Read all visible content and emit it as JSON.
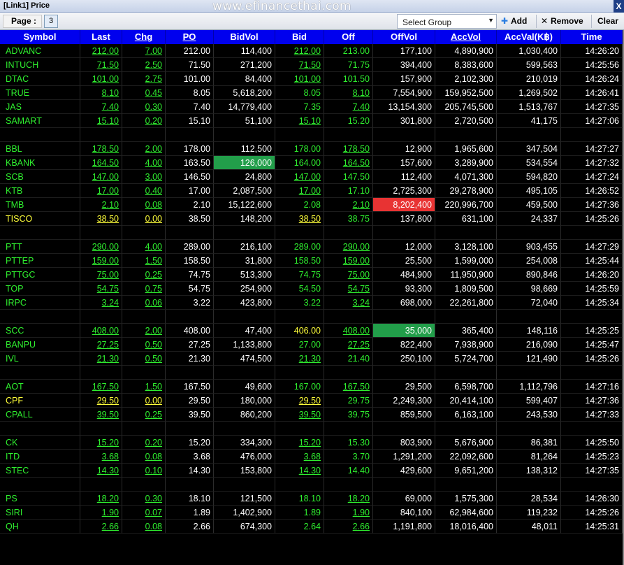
{
  "window": {
    "title": "[Link1] Price",
    "watermark": "www.efinancethai.com",
    "close_label": "X"
  },
  "toolbar": {
    "page_label": "Page :",
    "page_value": "3",
    "group_select": "Select Group",
    "add_label": "Add",
    "remove_label": "Remove",
    "clear_label": "Clear"
  },
  "columns": [
    "Symbol",
    "Last",
    "Chg",
    "PO",
    "BidVol",
    "Bid",
    "Off",
    "OffVol",
    "AccVol",
    "AccVal(K฿)",
    "Time"
  ],
  "colors": {
    "up": "#2ff02f",
    "unchanged": "#ffff3a",
    "header_bg": "#0000ee",
    "hl_green": "#229e4a",
    "hl_red": "#e83333"
  },
  "rows": [
    {
      "symbol": "ADVANC",
      "last": "212.00",
      "chg": "7.00",
      "po": "212.00",
      "bidvol": "114,400",
      "bid": "212.00",
      "off": "213.00",
      "offvol": "177,100",
      "accvol": "4,890,900",
      "accval": "1,030,400",
      "time": "14:26:20",
      "color": "green"
    },
    {
      "symbol": "INTUCH",
      "last": "71.50",
      "chg": "2.50",
      "po": "71.50",
      "bidvol": "271,200",
      "bid": "71.50",
      "off": "71.75",
      "offvol": "394,400",
      "accvol": "8,383,600",
      "accval": "599,563",
      "time": "14:25:56",
      "color": "green"
    },
    {
      "symbol": "DTAC",
      "last": "101.00",
      "chg": "2.75",
      "po": "101.00",
      "bidvol": "84,400",
      "bid": "101.00",
      "off": "101.50",
      "offvol": "157,900",
      "accvol": "2,102,300",
      "accval": "210,019",
      "time": "14:26:24",
      "color": "green"
    },
    {
      "symbol": "TRUE",
      "last": "8.10",
      "chg": "0.45",
      "po": "8.05",
      "bidvol": "5,618,200",
      "bid": "8.05",
      "off": "8.10",
      "offvol": "7,554,900",
      "accvol": "159,952,500",
      "accval": "1,269,502",
      "time": "14:26:41",
      "color": "green",
      "bid_plain": true,
      "off_ul": true
    },
    {
      "symbol": "JAS",
      "last": "7.40",
      "chg": "0.30",
      "po": "7.40",
      "bidvol": "14,779,400",
      "bid": "7.35",
      "off": "7.40",
      "offvol": "13,154,300",
      "accvol": "205,745,500",
      "accval": "1,513,767",
      "time": "14:27:35",
      "color": "green",
      "bid_plain": true,
      "off_ul": true
    },
    {
      "symbol": "SAMART",
      "last": "15.10",
      "chg": "0.20",
      "po": "15.10",
      "bidvol": "51,100",
      "bid": "15.10",
      "off": "15.20",
      "offvol": "301,800",
      "accvol": "2,720,500",
      "accval": "41,175",
      "time": "14:27:06",
      "color": "green"
    },
    {
      "blank": true
    },
    {
      "symbol": "BBL",
      "last": "178.50",
      "chg": "2.00",
      "po": "178.00",
      "bidvol": "112,500",
      "bid": "178.00",
      "off": "178.50",
      "offvol": "12,900",
      "accvol": "1,965,600",
      "accval": "347,504",
      "time": "14:27:27",
      "color": "green",
      "bid_plain": true,
      "off_ul": true
    },
    {
      "symbol": "KBANK",
      "last": "164.50",
      "chg": "4.00",
      "po": "163.50",
      "bidvol": "126,000",
      "bid": "164.00",
      "off": "164.50",
      "offvol": "157,600",
      "accvol": "3,289,900",
      "accval": "534,554",
      "time": "14:27:32",
      "color": "green",
      "bid_plain": true,
      "off_ul": true,
      "bidvol_hl": "green"
    },
    {
      "symbol": "SCB",
      "last": "147.00",
      "chg": "3.00",
      "po": "146.50",
      "bidvol": "24,800",
      "bid": "147.00",
      "off": "147.50",
      "offvol": "112,400",
      "accvol": "4,071,300",
      "accval": "594,820",
      "time": "14:27:24",
      "color": "green"
    },
    {
      "symbol": "KTB",
      "last": "17.00",
      "chg": "0.40",
      "po": "17.00",
      "bidvol": "2,087,500",
      "bid": "17.00",
      "off": "17.10",
      "offvol": "2,725,300",
      "accvol": "29,278,900",
      "accval": "495,105",
      "time": "14:26:52",
      "color": "green"
    },
    {
      "symbol": "TMB",
      "last": "2.10",
      "chg": "0.08",
      "po": "2.10",
      "bidvol": "15,122,600",
      "bid": "2.08",
      "off": "2.10",
      "offvol": "8,202,400",
      "accvol": "220,996,700",
      "accval": "459,500",
      "time": "14:27:36",
      "color": "green",
      "bid_plain": true,
      "off_ul": true,
      "offvol_hl": "red"
    },
    {
      "symbol": "TISCO",
      "last": "38.50",
      "chg": "0.00",
      "po": "38.50",
      "bidvol": "148,200",
      "bid": "38.50",
      "off": "38.75",
      "offvol": "137,800",
      "accvol": "631,100",
      "accval": "24,337",
      "time": "14:25:26",
      "color": "yellow",
      "bid_yellow": true
    },
    {
      "blank": true
    },
    {
      "symbol": "PTT",
      "last": "290.00",
      "chg": "4.00",
      "po": "289.00",
      "bidvol": "216,100",
      "bid": "289.00",
      "off": "290.00",
      "offvol": "12,000",
      "accvol": "3,128,100",
      "accval": "903,455",
      "time": "14:27:29",
      "color": "green",
      "bid_plain": true,
      "off_ul": true
    },
    {
      "symbol": "PTTEP",
      "last": "159.00",
      "chg": "1.50",
      "po": "158.50",
      "bidvol": "31,800",
      "bid": "158.50",
      "off": "159.00",
      "offvol": "25,500",
      "accvol": "1,599,000",
      "accval": "254,008",
      "time": "14:25:44",
      "color": "green",
      "bid_plain": true,
      "off_ul": true
    },
    {
      "symbol": "PTTGC",
      "last": "75.00",
      "chg": "0.25",
      "po": "74.75",
      "bidvol": "513,300",
      "bid": "74.75",
      "off": "75.00",
      "offvol": "484,900",
      "accvol": "11,950,900",
      "accval": "890,846",
      "time": "14:26:20",
      "color": "green",
      "bid_plain": true,
      "off_ul": true
    },
    {
      "symbol": "TOP",
      "last": "54.75",
      "chg": "0.75",
      "po": "54.75",
      "bidvol": "254,900",
      "bid": "54.50",
      "off": "54.75",
      "offvol": "93,300",
      "accvol": "1,809,500",
      "accval": "98,669",
      "time": "14:25:59",
      "color": "green",
      "bid_plain": true,
      "off_ul": true
    },
    {
      "symbol": "IRPC",
      "last": "3.24",
      "chg": "0.06",
      "po": "3.22",
      "bidvol": "423,800",
      "bid": "3.22",
      "off": "3.24",
      "offvol": "698,000",
      "accvol": "22,261,800",
      "accval": "72,040",
      "time": "14:25:34",
      "color": "green",
      "bid_plain": true,
      "off_ul": true
    },
    {
      "blank": true
    },
    {
      "symbol": "SCC",
      "last": "408.00",
      "chg": "2.00",
      "po": "408.00",
      "bidvol": "47,400",
      "bid": "406.00",
      "off": "408.00",
      "offvol": "35,000",
      "accvol": "365,400",
      "accval": "148,116",
      "time": "14:25:25",
      "color": "green",
      "bid_yellow_plain": true,
      "off_ul": true,
      "offvol_hl": "green"
    },
    {
      "symbol": "BANPU",
      "last": "27.25",
      "chg": "0.50",
      "po": "27.25",
      "bidvol": "1,133,800",
      "bid": "27.00",
      "off": "27.25",
      "offvol": "822,400",
      "accvol": "7,938,900",
      "accval": "216,090",
      "time": "14:25:47",
      "color": "green",
      "bid_plain": true,
      "off_ul": true
    },
    {
      "symbol": "IVL",
      "last": "21.30",
      "chg": "0.50",
      "po": "21.30",
      "bidvol": "474,500",
      "bid": "21.30",
      "off": "21.40",
      "offvol": "250,100",
      "accvol": "5,724,700",
      "accval": "121,490",
      "time": "14:25:26",
      "color": "green"
    },
    {
      "blank": true
    },
    {
      "symbol": "AOT",
      "last": "167.50",
      "chg": "1.50",
      "po": "167.50",
      "bidvol": "49,600",
      "bid": "167.00",
      "off": "167.50",
      "offvol": "29,500",
      "accvol": "6,598,700",
      "accval": "1,112,796",
      "time": "14:27:16",
      "color": "green",
      "bid_plain": true,
      "off_ul": true
    },
    {
      "symbol": "CPF",
      "last": "29.50",
      "chg": "0.00",
      "po": "29.50",
      "bidvol": "180,000",
      "bid": "29.50",
      "off": "29.75",
      "offvol": "2,249,300",
      "accvol": "20,414,100",
      "accval": "599,407",
      "time": "14:27:36",
      "color": "yellow",
      "bid_yellow": true
    },
    {
      "symbol": "CPALL",
      "last": "39.50",
      "chg": "0.25",
      "po": "39.50",
      "bidvol": "860,200",
      "bid": "39.50",
      "off": "39.75",
      "offvol": "859,500",
      "accvol": "6,163,100",
      "accval": "243,530",
      "time": "14:27:33",
      "color": "green"
    },
    {
      "blank": true
    },
    {
      "symbol": "CK",
      "last": "15.20",
      "chg": "0.20",
      "po": "15.20",
      "bidvol": "334,300",
      "bid": "15.20",
      "off": "15.30",
      "offvol": "803,900",
      "accvol": "5,676,900",
      "accval": "86,381",
      "time": "14:25:50",
      "color": "green"
    },
    {
      "symbol": "ITD",
      "last": "3.68",
      "chg": "0.08",
      "po": "3.68",
      "bidvol": "476,000",
      "bid": "3.68",
      "off": "3.70",
      "offvol": "1,291,200",
      "accvol": "22,092,600",
      "accval": "81,264",
      "time": "14:25:23",
      "color": "green"
    },
    {
      "symbol": "STEC",
      "last": "14.30",
      "chg": "0.10",
      "po": "14.30",
      "bidvol": "153,800",
      "bid": "14.30",
      "off": "14.40",
      "offvol": "429,600",
      "accvol": "9,651,200",
      "accval": "138,312",
      "time": "14:27:35",
      "color": "green"
    },
    {
      "blank": true
    },
    {
      "symbol": "PS",
      "last": "18.20",
      "chg": "0.30",
      "po": "18.10",
      "bidvol": "121,500",
      "bid": "18.10",
      "off": "18.20",
      "offvol": "69,000",
      "accvol": "1,575,300",
      "accval": "28,534",
      "time": "14:26:30",
      "color": "green",
      "bid_plain": true,
      "off_ul": true
    },
    {
      "symbol": "SIRI",
      "last": "1.90",
      "chg": "0.07",
      "po": "1.89",
      "bidvol": "1,402,900",
      "bid": "1.89",
      "off": "1.90",
      "offvol": "840,100",
      "accvol": "62,984,600",
      "accval": "119,232",
      "time": "14:25:26",
      "color": "green",
      "bid_plain": true,
      "off_ul": true
    },
    {
      "symbol": "QH",
      "last": "2.66",
      "chg": "0.08",
      "po": "2.66",
      "bidvol": "674,300",
      "bid": "2.64",
      "off": "2.66",
      "offvol": "1,191,800",
      "accvol": "18,016,400",
      "accval": "48,011",
      "time": "14:25:31",
      "color": "green",
      "bid_plain": true,
      "off_ul": true
    }
  ]
}
